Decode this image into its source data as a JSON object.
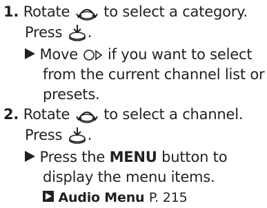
{
  "steps": [
    {
      "number": "1.",
      "text_a": "Rotate",
      "icon": "rotary-dial-icon",
      "text_b": "to select a category.",
      "press_text": "Press",
      "press_icon": "push-dial-icon",
      "press_end": ".",
      "note": {
        "marker_icon": "right-triangle-icon",
        "line1_a": "Move",
        "move_icon": "move-right-icon",
        "line1_b": "if you want to select",
        "line2": "from the current channel list or",
        "line3": "presets."
      }
    },
    {
      "number": "2.",
      "text_a": "Rotate",
      "icon": "rotary-dial-icon",
      "text_b": "to select a channel.",
      "press_text": "Press",
      "press_icon": "push-dial-icon",
      "press_end": ".",
      "note": {
        "marker_icon": "right-triangle-icon",
        "line1_a": "Press the",
        "line1_bold": "MENU",
        "line1_b": "button to",
        "line2": "display the menu items."
      },
      "reference": {
        "icon": "cross-reference-arrow-icon",
        "title": "Audio Menu",
        "page": "P. 215"
      }
    }
  ]
}
